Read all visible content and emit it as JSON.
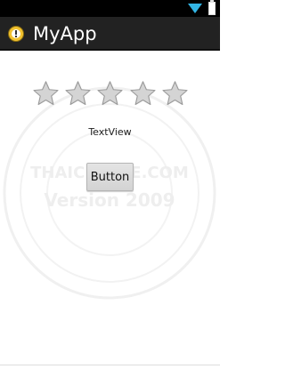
{
  "action_bar": {
    "title": "MyApp",
    "app_icon": "app-logo-icon"
  },
  "status_bar": {
    "icons": [
      "wifi-icon",
      "battery-icon"
    ]
  },
  "rating": {
    "max": 5,
    "value": 0
  },
  "text_view": "TextView",
  "button_label": "Button",
  "watermark": {
    "line1": "THAICREATE.COM",
    "line2": "Version 2009"
  }
}
